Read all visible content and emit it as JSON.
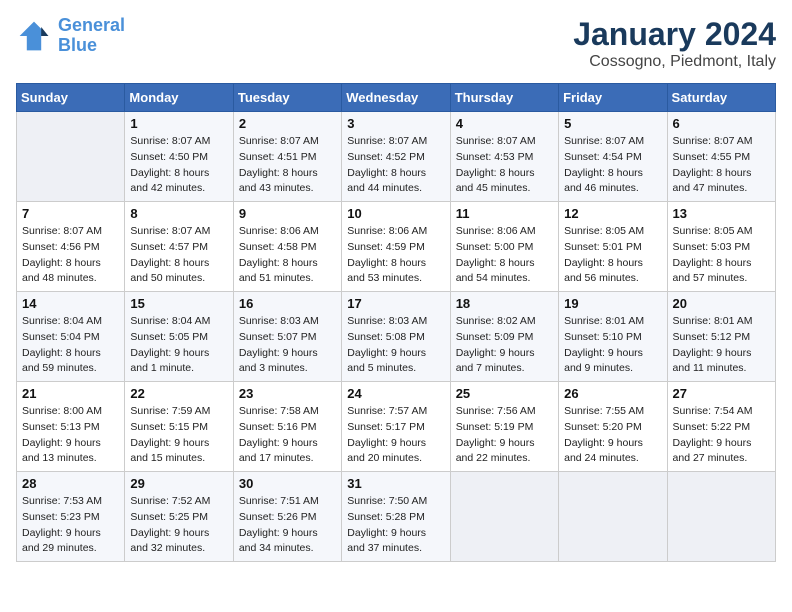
{
  "logo": {
    "line1": "General",
    "line2": "Blue"
  },
  "title": "January 2024",
  "subtitle": "Cossogno, Piedmont, Italy",
  "days_of_week": [
    "Sunday",
    "Monday",
    "Tuesday",
    "Wednesday",
    "Thursday",
    "Friday",
    "Saturday"
  ],
  "weeks": [
    [
      {
        "day": "",
        "sunrise": "",
        "sunset": "",
        "daylight": ""
      },
      {
        "day": "1",
        "sunrise": "Sunrise: 8:07 AM",
        "sunset": "Sunset: 4:50 PM",
        "daylight": "Daylight: 8 hours and 42 minutes."
      },
      {
        "day": "2",
        "sunrise": "Sunrise: 8:07 AM",
        "sunset": "Sunset: 4:51 PM",
        "daylight": "Daylight: 8 hours and 43 minutes."
      },
      {
        "day": "3",
        "sunrise": "Sunrise: 8:07 AM",
        "sunset": "Sunset: 4:52 PM",
        "daylight": "Daylight: 8 hours and 44 minutes."
      },
      {
        "day": "4",
        "sunrise": "Sunrise: 8:07 AM",
        "sunset": "Sunset: 4:53 PM",
        "daylight": "Daylight: 8 hours and 45 minutes."
      },
      {
        "day": "5",
        "sunrise": "Sunrise: 8:07 AM",
        "sunset": "Sunset: 4:54 PM",
        "daylight": "Daylight: 8 hours and 46 minutes."
      },
      {
        "day": "6",
        "sunrise": "Sunrise: 8:07 AM",
        "sunset": "Sunset: 4:55 PM",
        "daylight": "Daylight: 8 hours and 47 minutes."
      }
    ],
    [
      {
        "day": "7",
        "sunrise": "Sunrise: 8:07 AM",
        "sunset": "Sunset: 4:56 PM",
        "daylight": "Daylight: 8 hours and 48 minutes."
      },
      {
        "day": "8",
        "sunrise": "Sunrise: 8:07 AM",
        "sunset": "Sunset: 4:57 PM",
        "daylight": "Daylight: 8 hours and 50 minutes."
      },
      {
        "day": "9",
        "sunrise": "Sunrise: 8:06 AM",
        "sunset": "Sunset: 4:58 PM",
        "daylight": "Daylight: 8 hours and 51 minutes."
      },
      {
        "day": "10",
        "sunrise": "Sunrise: 8:06 AM",
        "sunset": "Sunset: 4:59 PM",
        "daylight": "Daylight: 8 hours and 53 minutes."
      },
      {
        "day": "11",
        "sunrise": "Sunrise: 8:06 AM",
        "sunset": "Sunset: 5:00 PM",
        "daylight": "Daylight: 8 hours and 54 minutes."
      },
      {
        "day": "12",
        "sunrise": "Sunrise: 8:05 AM",
        "sunset": "Sunset: 5:01 PM",
        "daylight": "Daylight: 8 hours and 56 minutes."
      },
      {
        "day": "13",
        "sunrise": "Sunrise: 8:05 AM",
        "sunset": "Sunset: 5:03 PM",
        "daylight": "Daylight: 8 hours and 57 minutes."
      }
    ],
    [
      {
        "day": "14",
        "sunrise": "Sunrise: 8:04 AM",
        "sunset": "Sunset: 5:04 PM",
        "daylight": "Daylight: 8 hours and 59 minutes."
      },
      {
        "day": "15",
        "sunrise": "Sunrise: 8:04 AM",
        "sunset": "Sunset: 5:05 PM",
        "daylight": "Daylight: 9 hours and 1 minute."
      },
      {
        "day": "16",
        "sunrise": "Sunrise: 8:03 AM",
        "sunset": "Sunset: 5:07 PM",
        "daylight": "Daylight: 9 hours and 3 minutes."
      },
      {
        "day": "17",
        "sunrise": "Sunrise: 8:03 AM",
        "sunset": "Sunset: 5:08 PM",
        "daylight": "Daylight: 9 hours and 5 minutes."
      },
      {
        "day": "18",
        "sunrise": "Sunrise: 8:02 AM",
        "sunset": "Sunset: 5:09 PM",
        "daylight": "Daylight: 9 hours and 7 minutes."
      },
      {
        "day": "19",
        "sunrise": "Sunrise: 8:01 AM",
        "sunset": "Sunset: 5:10 PM",
        "daylight": "Daylight: 9 hours and 9 minutes."
      },
      {
        "day": "20",
        "sunrise": "Sunrise: 8:01 AM",
        "sunset": "Sunset: 5:12 PM",
        "daylight": "Daylight: 9 hours and 11 minutes."
      }
    ],
    [
      {
        "day": "21",
        "sunrise": "Sunrise: 8:00 AM",
        "sunset": "Sunset: 5:13 PM",
        "daylight": "Daylight: 9 hours and 13 minutes."
      },
      {
        "day": "22",
        "sunrise": "Sunrise: 7:59 AM",
        "sunset": "Sunset: 5:15 PM",
        "daylight": "Daylight: 9 hours and 15 minutes."
      },
      {
        "day": "23",
        "sunrise": "Sunrise: 7:58 AM",
        "sunset": "Sunset: 5:16 PM",
        "daylight": "Daylight: 9 hours and 17 minutes."
      },
      {
        "day": "24",
        "sunrise": "Sunrise: 7:57 AM",
        "sunset": "Sunset: 5:17 PM",
        "daylight": "Daylight: 9 hours and 20 minutes."
      },
      {
        "day": "25",
        "sunrise": "Sunrise: 7:56 AM",
        "sunset": "Sunset: 5:19 PM",
        "daylight": "Daylight: 9 hours and 22 minutes."
      },
      {
        "day": "26",
        "sunrise": "Sunrise: 7:55 AM",
        "sunset": "Sunset: 5:20 PM",
        "daylight": "Daylight: 9 hours and 24 minutes."
      },
      {
        "day": "27",
        "sunrise": "Sunrise: 7:54 AM",
        "sunset": "Sunset: 5:22 PM",
        "daylight": "Daylight: 9 hours and 27 minutes."
      }
    ],
    [
      {
        "day": "28",
        "sunrise": "Sunrise: 7:53 AM",
        "sunset": "Sunset: 5:23 PM",
        "daylight": "Daylight: 9 hours and 29 minutes."
      },
      {
        "day": "29",
        "sunrise": "Sunrise: 7:52 AM",
        "sunset": "Sunset: 5:25 PM",
        "daylight": "Daylight: 9 hours and 32 minutes."
      },
      {
        "day": "30",
        "sunrise": "Sunrise: 7:51 AM",
        "sunset": "Sunset: 5:26 PM",
        "daylight": "Daylight: 9 hours and 34 minutes."
      },
      {
        "day": "31",
        "sunrise": "Sunrise: 7:50 AM",
        "sunset": "Sunset: 5:28 PM",
        "daylight": "Daylight: 9 hours and 37 minutes."
      },
      {
        "day": "",
        "sunrise": "",
        "sunset": "",
        "daylight": ""
      },
      {
        "day": "",
        "sunrise": "",
        "sunset": "",
        "daylight": ""
      },
      {
        "day": "",
        "sunrise": "",
        "sunset": "",
        "daylight": ""
      }
    ]
  ]
}
